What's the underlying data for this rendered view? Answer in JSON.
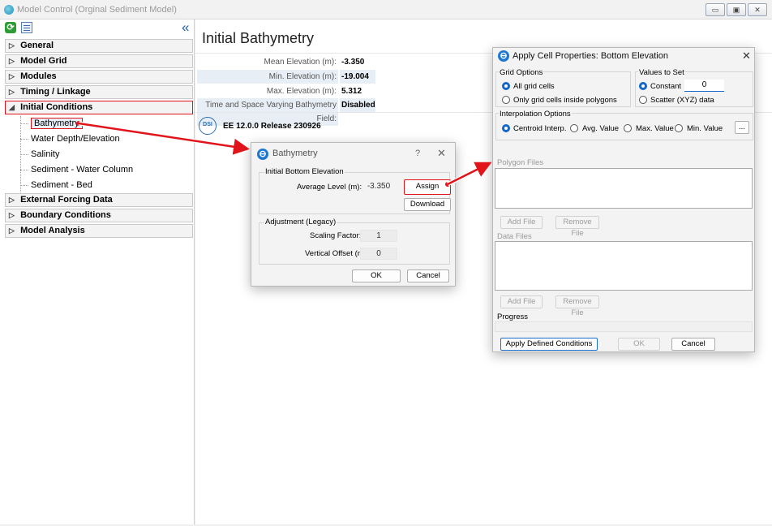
{
  "window": {
    "title": "Model Control (Orginal Sediment Model)",
    "buttons": [
      "▭",
      "▣",
      "✕"
    ]
  },
  "left_panel": {
    "collapse_glyph": "«",
    "groups": [
      {
        "label": "General",
        "arrow": "▷"
      },
      {
        "label": "Model Grid",
        "arrow": "▷"
      },
      {
        "label": "Modules",
        "arrow": "▷"
      },
      {
        "label": "Timing / Linkage",
        "arrow": "▷"
      },
      {
        "label": "Initial Conditions",
        "arrow": "◢"
      }
    ],
    "children": [
      "Bathymetry",
      "Water Depth/Elevation",
      "Salinity",
      "Sediment - Water Column",
      "Sediment - Bed"
    ],
    "groups_after": [
      {
        "label": "External Forcing Data",
        "arrow": "▷"
      },
      {
        "label": "Boundary Conditions",
        "arrow": "▷"
      },
      {
        "label": "Model Analysis",
        "arrow": "▷"
      }
    ]
  },
  "main": {
    "title": "Initial Bathymetry",
    "props": [
      {
        "key": "Mean Elevation (m):",
        "value": "-3.350"
      },
      {
        "key": "Min. Elevation (m):",
        "value": "-19.004"
      },
      {
        "key": "Max. Elevation (m):",
        "value": "5.312"
      },
      {
        "key": "Time and Space Varying Bathymetry Field:",
        "value": "Disabled"
      }
    ],
    "logo_text": "DSI",
    "release": "EE 12.0.0 Release 230926"
  },
  "bathymetry_dialog": {
    "title": "Bathymetry",
    "help": "?",
    "close": "✕",
    "group1_legend": "Initial Bottom Elevation",
    "avg_label": "Average Level (m):",
    "avg_value": "-3.350",
    "assign": "Assign",
    "download": "Download",
    "group2_legend": "Adjustment (Legacy)",
    "scaling_label": "Scaling Factor:",
    "scaling_value": "1",
    "offset_label": "Vertical Offset (m):",
    "offset_value": "0",
    "ok": "OK",
    "cancel": "Cancel"
  },
  "apply_dialog": {
    "title": "Apply Cell Properties: Bottom Elevation",
    "close": "✕",
    "grid_options_legend": "Grid Options",
    "grid_opt_all": "All grid cells",
    "grid_opt_polygons": "Only grid cells inside polygons",
    "values_legend": "Values to Set",
    "constant_label": "Constant",
    "constant_value": "0",
    "scatter_label": "Scatter (XYZ) data",
    "interp_legend": "Interpolation Options",
    "interp_opts": [
      "Centroid Interp.",
      "Avg. Value",
      "Max. Value",
      "Min. Value"
    ],
    "more_btn": "...",
    "polygon_legend": "Polygon Files",
    "add_file": "Add File",
    "remove_file": "Remove File",
    "data_legend": "Data Files",
    "progress_label": "Progress",
    "apply_btn": "Apply Defined Conditions",
    "ok": "OK",
    "cancel": "Cancel"
  },
  "colors": {
    "highlight_red": "#e0141a",
    "accent_blue": "#1566c8"
  }
}
